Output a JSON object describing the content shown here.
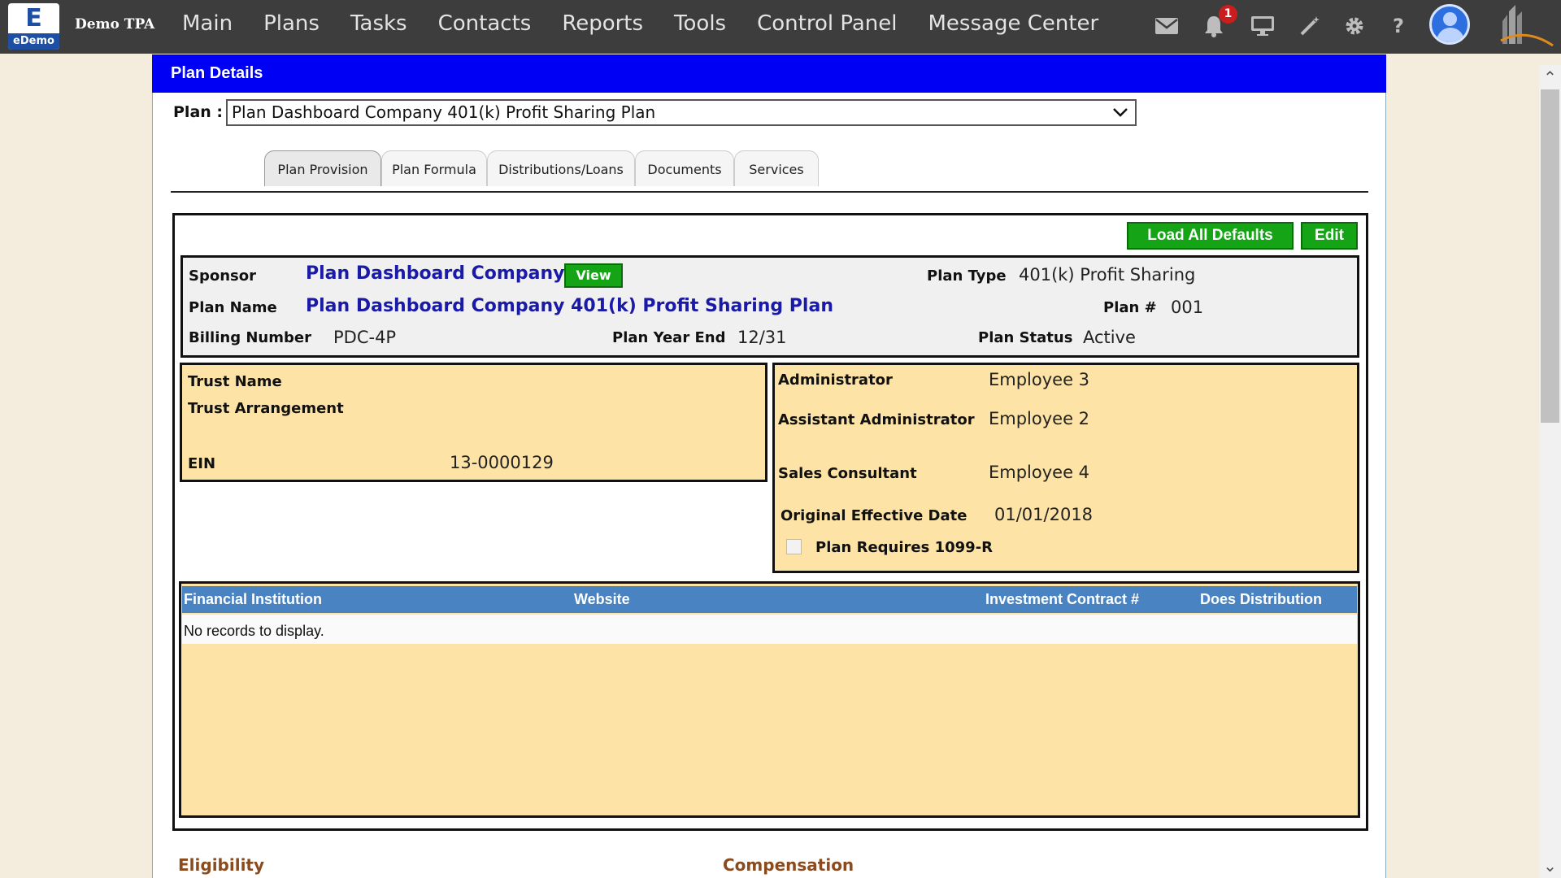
{
  "app": {
    "logo_letter": "E",
    "logo_text": "eDemo",
    "tpa_name": "Demo TPA"
  },
  "nav": [
    "Main",
    "Plans",
    "Tasks",
    "Contacts",
    "Reports",
    "Tools",
    "Control Panel",
    "Message Center"
  ],
  "notifications": {
    "count": "1"
  },
  "icons": [
    "mail-icon",
    "bell-icon",
    "monitor-icon",
    "magic-wand-icon",
    "gear-icon",
    "help-icon",
    "user-avatar-icon",
    "buildings-logo-icon"
  ],
  "panel": {
    "title": "Plan Details",
    "plan_label": "Plan :",
    "plan_selected": "Plan Dashboard Company 401(k) Profit Sharing Plan"
  },
  "tabs": [
    "Plan Provision",
    "Plan Formula",
    "Distributions/Loans",
    "Documents",
    "Services"
  ],
  "buttons": {
    "load_defaults": "Load All Defaults",
    "edit": "Edit",
    "view": "View"
  },
  "sponsor": {
    "sponsor_label": "Sponsor",
    "sponsor_value": "Plan Dashboard Company",
    "plan_type_label": "Plan Type",
    "plan_type_value": "401(k) Profit Sharing",
    "plan_name_label": "Plan Name",
    "plan_name_value": "Plan Dashboard Company 401(k) Profit Sharing Plan",
    "plan_num_label": "Plan #",
    "plan_num_value": "001",
    "billing_label": "Billing Number",
    "billing_value": "PDC-4P",
    "year_end_label": "Plan Year End",
    "year_end_value": "12/31",
    "status_label": "Plan Status",
    "status_value": "Active"
  },
  "trust": {
    "name_label": "Trust Name",
    "arrangement_label": "Trust Arrangement",
    "ein_label": "EIN",
    "ein_value": "13-0000129"
  },
  "admin": {
    "administrator_label": "Administrator",
    "administrator_value": "Employee 3",
    "assistant_label": "Assistant Administrator",
    "assistant_value": "Employee 2",
    "sales_label": "Sales Consultant",
    "sales_value": "Employee 4",
    "effective_label": "Original Effective Date",
    "effective_value": "01/01/2018",
    "requires_1099_label": "Plan Requires 1099-R",
    "requires_1099_checked": false
  },
  "financial": {
    "columns": [
      "Financial Institution",
      "Website",
      "Investment Contract #",
      "Does Distribution"
    ],
    "empty_text": "No records to display."
  },
  "sections": {
    "eligibility": "Eligibility",
    "compensation": "Compensation"
  },
  "colors": {
    "nav_bg": "#3d3d3d",
    "panel_header": "#0000f5",
    "green": "#15a415",
    "peach": "#fde3a5",
    "table_header": "#4a83c2",
    "link": "#1a1aa8"
  }
}
